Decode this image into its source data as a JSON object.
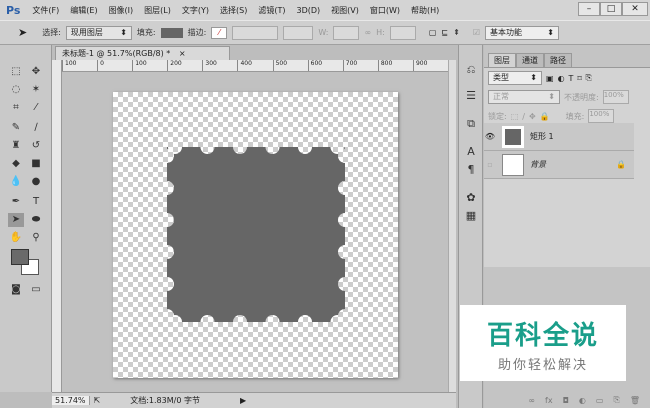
{
  "app": {
    "logo": "Ps"
  },
  "menu": [
    "文件(F)",
    "编辑(E)",
    "图像(I)",
    "图层(L)",
    "文字(Y)",
    "选择(S)",
    "滤镜(T)",
    "3D(D)",
    "视图(V)",
    "窗口(W)",
    "帮助(H)"
  ],
  "window_controls": {
    "minimize": "–",
    "maximize": "□",
    "close": "✕"
  },
  "options": {
    "select_label": "选择:",
    "select_value": "现用图层",
    "fill_label": "填充:",
    "stroke_label": "描边:",
    "w_label": "W:",
    "h_label": "H:",
    "workspace": "基本功能"
  },
  "document": {
    "tab_title": "未标题-1 @ 51.7%(RGB/8) *",
    "close": "×",
    "ruler_ticks": [
      "100",
      "0",
      "100",
      "200",
      "300",
      "400",
      "500",
      "600",
      "700",
      "800",
      "900"
    ]
  },
  "status": {
    "zoom": "51.74%",
    "doc_info": "文档:1.83M/0 字节"
  },
  "layers_panel": {
    "tabs": [
      "图层",
      "通道",
      "路径"
    ],
    "filter": "类型",
    "blend_mode": "正常",
    "opacity_label": "不透明度:",
    "opacity": "100%",
    "lock_label": "锁定:",
    "fill_label": "填充:",
    "fill": "100%",
    "layers": [
      {
        "name": "矩形 1",
        "visible": true
      },
      {
        "name": "背景",
        "visible": false
      }
    ]
  },
  "watermark": {
    "title": "百科全说",
    "subtitle": "助你轻松解决"
  },
  "colors": {
    "shape": "#666666",
    "watermark": "#1a9e8a"
  }
}
